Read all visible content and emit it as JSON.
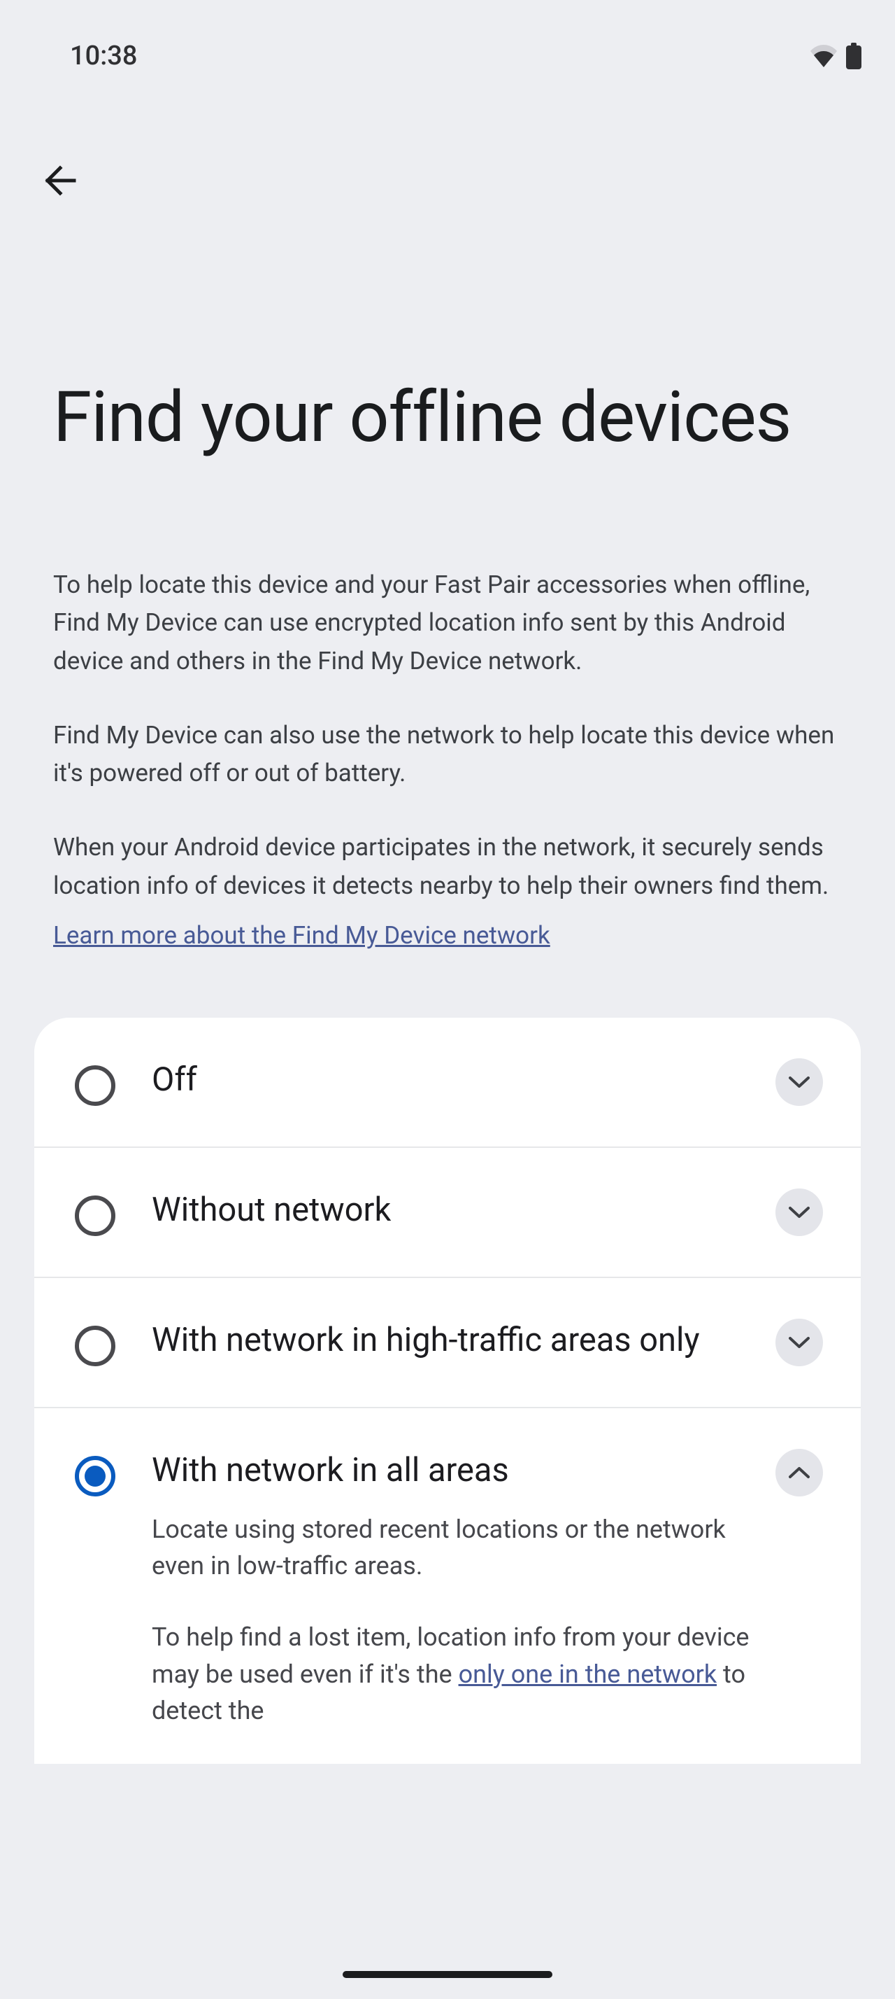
{
  "status": {
    "time": "10:38"
  },
  "page": {
    "title": "Find your offline devices",
    "description1": "To help locate this device and your Fast Pair accessories when offline, Find My Device can use encrypted location info sent by this Android device and others in the Find My Device network.",
    "description2": "Find My Device can also use the network to help locate this device when it's powered off or out of battery.",
    "description3": "When your Android device participates in the network, it securely sends location info of devices it detects nearby to help their owners find them.",
    "learn_more": "Learn more about the Find My Device network"
  },
  "options": {
    "off": {
      "label": "Off",
      "selected": false,
      "expanded": false
    },
    "without_network": {
      "label": "Without network",
      "selected": false,
      "expanded": false
    },
    "high_traffic": {
      "label": "With network in high-traffic areas only",
      "selected": false,
      "expanded": false
    },
    "all_areas": {
      "label": "With network in all areas",
      "selected": true,
      "expanded": true,
      "desc1": "Locate using stored recent locations or the network even in low-traffic areas.",
      "desc2_prefix": "To help find a lost item, location info from your device may be used even if it's the ",
      "desc2_link": "only one in the network",
      "desc2_suffix": " to detect the"
    }
  }
}
